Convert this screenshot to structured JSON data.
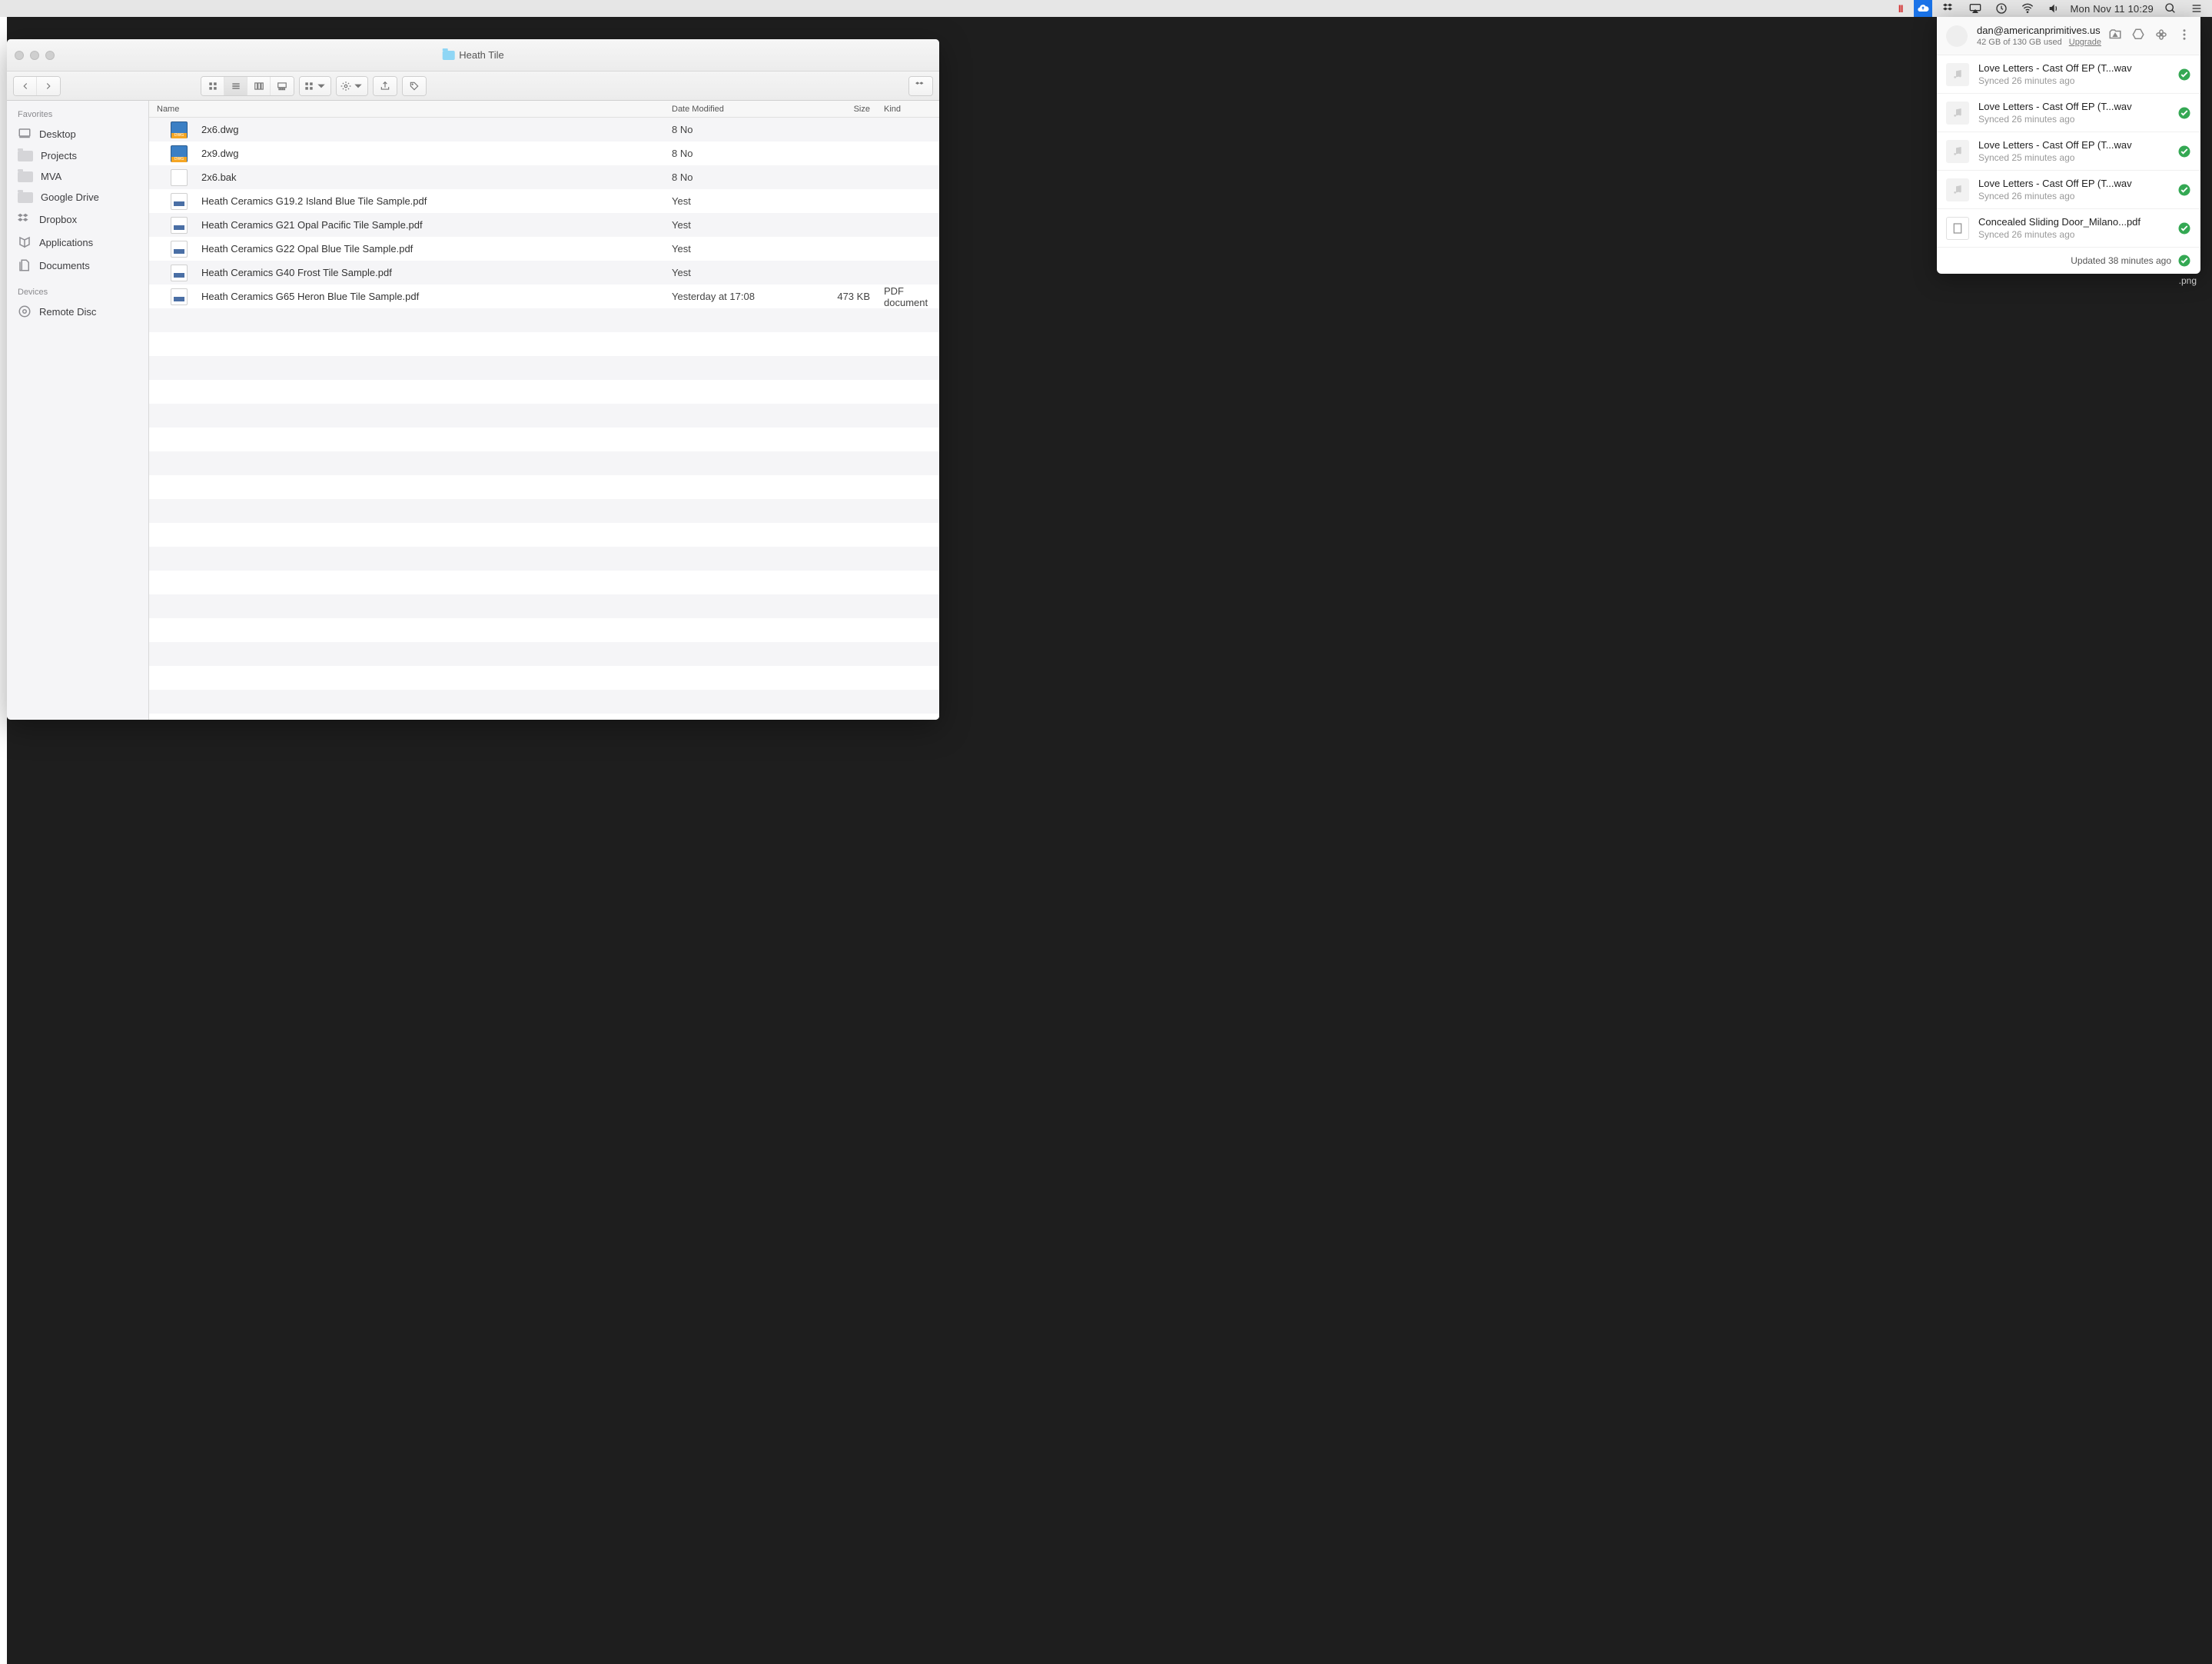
{
  "menubar": {
    "date_time": "Mon Nov 11  10:29"
  },
  "finder": {
    "title": "Heath Tile",
    "sidebar": {
      "section_favorites": "Favorites",
      "section_devices": "Devices",
      "favorites": [
        {
          "label": "Desktop",
          "icon": "desktop"
        },
        {
          "label": "Projects",
          "icon": "folder"
        },
        {
          "label": "MVA",
          "icon": "folder"
        },
        {
          "label": "Google Drive",
          "icon": "folder"
        },
        {
          "label": "Dropbox",
          "icon": "dropbox"
        },
        {
          "label": "Applications",
          "icon": "apps"
        },
        {
          "label": "Documents",
          "icon": "documents"
        }
      ],
      "devices": [
        {
          "label": "Remote Disc",
          "icon": "disc"
        }
      ]
    },
    "columns": {
      "name": "Name",
      "date": "Date Modified",
      "size": "Size",
      "kind": "Kind"
    },
    "rows": [
      {
        "name": "2x6.dwg",
        "date": "8 No",
        "size": "",
        "kind": "",
        "icon": "dwg"
      },
      {
        "name": "2x9.dwg",
        "date": "8 No",
        "size": "",
        "kind": "",
        "icon": "dwg"
      },
      {
        "name": "2x6.bak",
        "date": "8 No",
        "size": "",
        "kind": "",
        "icon": "bak"
      },
      {
        "name": "Heath Ceramics G19.2 Island Blue Tile Sample.pdf",
        "date": "Yest",
        "size": "",
        "kind": "",
        "icon": "pdf"
      },
      {
        "name": "Heath Ceramics G21 Opal Pacific Tile Sample.pdf",
        "date": "Yest",
        "size": "",
        "kind": "",
        "icon": "pdf"
      },
      {
        "name": "Heath Ceramics G22 Opal Blue Tile Sample.pdf",
        "date": "Yest",
        "size": "",
        "kind": "",
        "icon": "pdf"
      },
      {
        "name": "Heath Ceramics G40 Frost Tile Sample.pdf",
        "date": "Yest",
        "size": "",
        "kind": "",
        "icon": "pdf"
      },
      {
        "name": "Heath Ceramics G65 Heron Blue Tile Sample.pdf",
        "date": "Yesterday at 17:08",
        "size": "473 KB",
        "kind": "PDF document",
        "icon": "pdf"
      }
    ]
  },
  "popover": {
    "email": "dan@americanprimitives.us",
    "storage": "42 GB of 130 GB used",
    "upgrade": "Upgrade",
    "items": [
      {
        "name": "Love Letters - Cast Off EP (T...wav",
        "status": "Synced 26 minutes ago",
        "thumb": "audio"
      },
      {
        "name": "Love Letters - Cast Off EP (T...wav",
        "status": "Synced 26 minutes ago",
        "thumb": "audio"
      },
      {
        "name": "Love Letters - Cast Off EP (T...wav",
        "status": "Synced 25 minutes ago",
        "thumb": "audio"
      },
      {
        "name": "Love Letters - Cast Off EP (T...wav",
        "status": "Synced 26 minutes ago",
        "thumb": "audio"
      },
      {
        "name": "Concealed Sliding Door_Milano...pdf",
        "status": "Synced 26 minutes ago",
        "thumb": "doc"
      }
    ],
    "footer": "Updated 38 minutes ago"
  },
  "background": {
    "peek_label": ".png"
  }
}
